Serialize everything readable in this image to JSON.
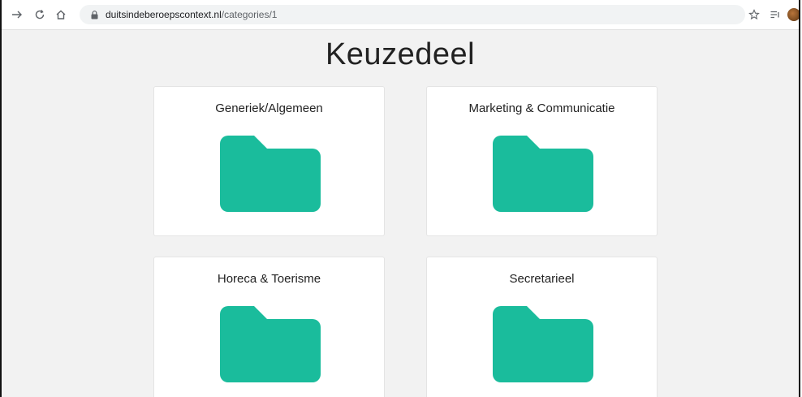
{
  "browser": {
    "url_domain": "duitsindeberoepscontext.nl",
    "url_path": "/categories/1"
  },
  "page": {
    "title": "Keuzedeel",
    "categories": [
      {
        "label": "Generiek/Algemeen"
      },
      {
        "label": "Marketing & Communicatie"
      },
      {
        "label": "Horeca & Toerisme"
      },
      {
        "label": "Secretarieel"
      }
    ]
  },
  "colors": {
    "folder": "#1abc9c",
    "page_background": "#f2f2f2"
  },
  "icons": [
    "back-arrow-icon",
    "reload-icon",
    "home-icon",
    "lock-icon",
    "star-icon",
    "reading-list-icon",
    "folder-icon"
  ]
}
